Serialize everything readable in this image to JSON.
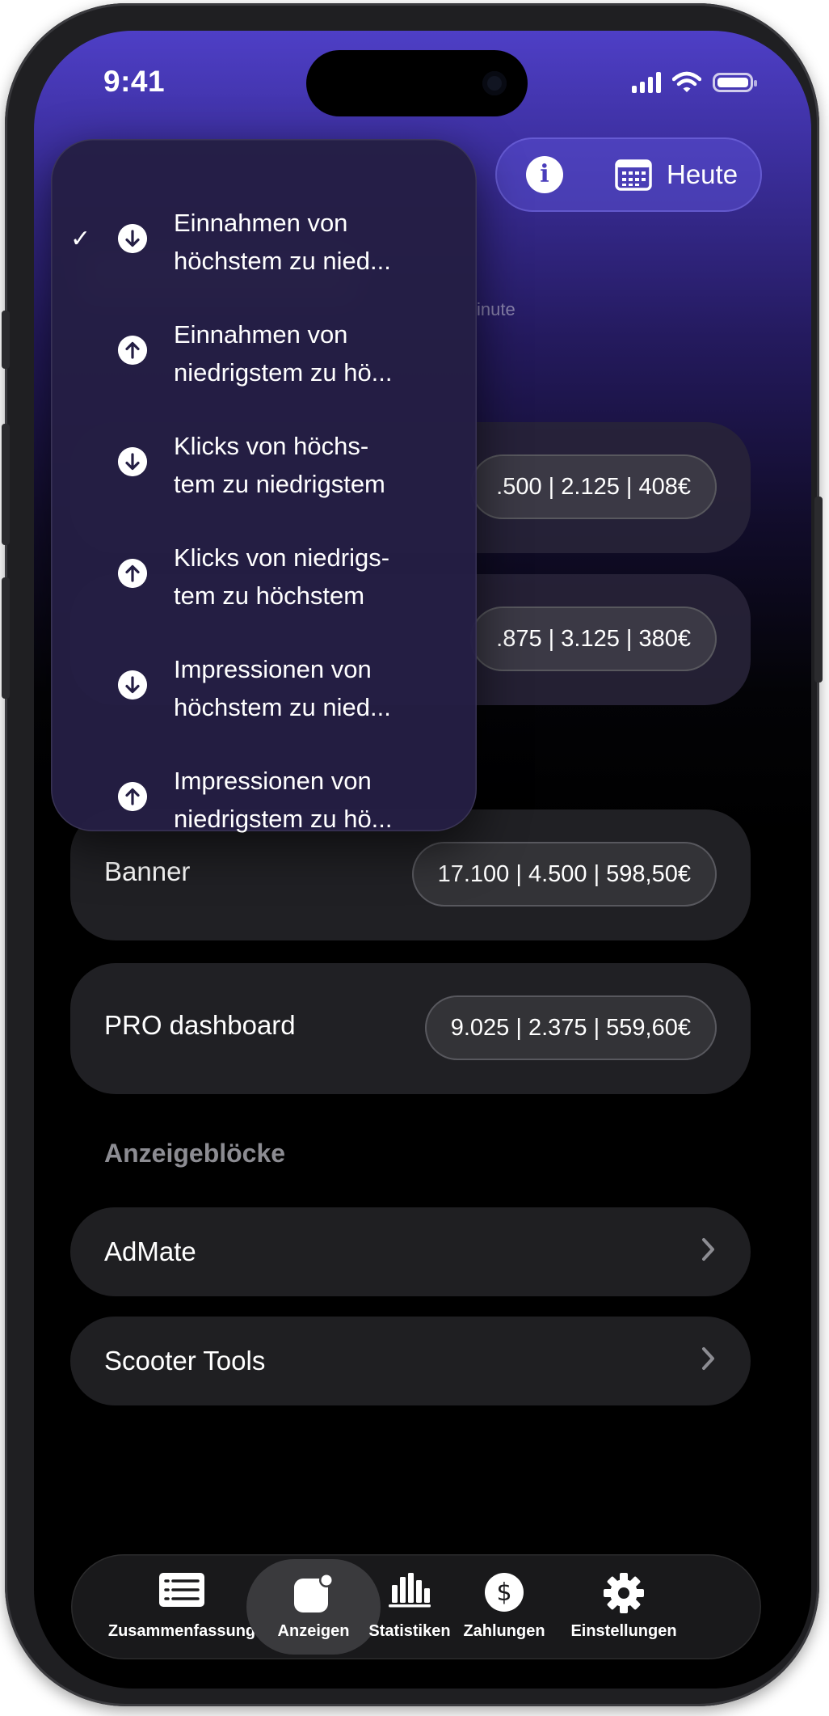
{
  "status_bar": {
    "time": "9:41"
  },
  "header": {
    "today_label": "Heute"
  },
  "blurred": {
    "subtitle_fragment": "inute"
  },
  "sort_menu": {
    "options": [
      {
        "line1": "Einnahmen von",
        "line2": "höchstem zu nied...",
        "direction": "down",
        "selected": true
      },
      {
        "line1": "Einnahmen von",
        "line2": "niedrigstem zu hö...",
        "direction": "up",
        "selected": false
      },
      {
        "line1": "Klicks von höchs-",
        "line2": "tem zu niedrigstem",
        "direction": "down",
        "selected": false
      },
      {
        "line1": "Klicks von niedrigs-",
        "line2": "tem zu höchstem",
        "direction": "up",
        "selected": false
      },
      {
        "line1": "Impressionen von",
        "line2": "höchstem zu nied...",
        "direction": "down",
        "selected": false
      },
      {
        "line1": "Impressionen von",
        "line2": "niedrigstem zu hö...",
        "direction": "up",
        "selected": false
      }
    ],
    "check_glyph": "✓"
  },
  "ads": [
    {
      "name": "",
      "stats": ".500 | 2.125 | 408€"
    },
    {
      "name": "",
      "stats": ".875 | 3.125 | 380€"
    },
    {
      "name": "Banner",
      "stats": "17.100 | 4.500 | 598,50€"
    },
    {
      "name": "PRO dashboard",
      "stats": "9.025 | 2.375 | 559,60€"
    }
  ],
  "ad_blocks": {
    "title": "Anzeigeblöcke",
    "items": [
      {
        "label": "AdMate"
      },
      {
        "label": "Scooter Tools"
      }
    ]
  },
  "tabbar": {
    "tabs": [
      {
        "label": "Zusammenfassung",
        "icon": "list-icon",
        "active": false
      },
      {
        "label": "Anzeigen",
        "icon": "ads-icon",
        "active": true
      },
      {
        "label": "Statistiken",
        "icon": "bar-chart-icon",
        "active": false
      },
      {
        "label": "Zahlungen",
        "icon": "dollar-icon",
        "active": false
      },
      {
        "label": "Einstellungen",
        "icon": "gear-icon",
        "active": false
      }
    ]
  },
  "colors": {
    "accent": "#4e3fc6",
    "card": "#1f1f22",
    "muted_text": "#8c8c92"
  }
}
